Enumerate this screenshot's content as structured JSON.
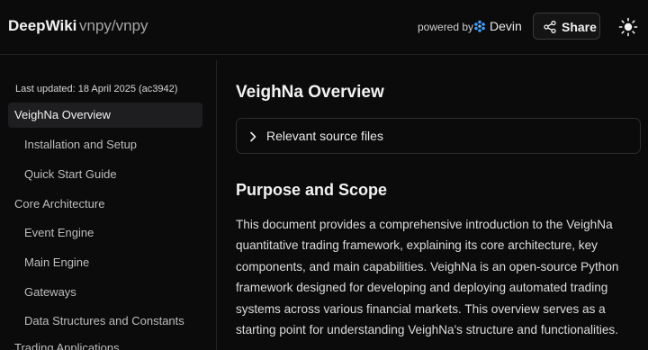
{
  "header": {
    "brand": "DeepWiki",
    "repo": "vnpy/vnpy",
    "powered_by": "powered by",
    "devin_label": "Devin",
    "share_label": "Share",
    "icons": {
      "devin": "devin-logo-icon",
      "share": "share-icon",
      "theme": "sun-icon"
    },
    "accent": "#3aa0ff"
  },
  "sidebar": {
    "last_updated": "Last updated: 18 April 2025 (ac3942)",
    "items": [
      {
        "label": "VeighNa Overview",
        "active": true
      },
      {
        "label": "Installation and Setup"
      },
      {
        "label": "Quick Start Guide"
      },
      {
        "label": "Core Architecture"
      },
      {
        "label": "Event Engine"
      },
      {
        "label": "Main Engine"
      },
      {
        "label": "Gateways"
      },
      {
        "label": "Data Structures and Constants"
      },
      {
        "label": "Trading Applications"
      }
    ]
  },
  "main": {
    "title": "VeighNa Overview",
    "source_files_label": "Relevant source files",
    "section_title": "Purpose and Scope",
    "paragraph": "This document provides a comprehensive introduction to the VeighNa quantitative trading framework, explaining its core architecture, key components, and main capabilities. VeighNa is an open-source Python framework designed for developing and deploying automated trading systems across various financial markets. This overview serves as a starting point for understanding VeighNa's structure and functionalities."
  }
}
